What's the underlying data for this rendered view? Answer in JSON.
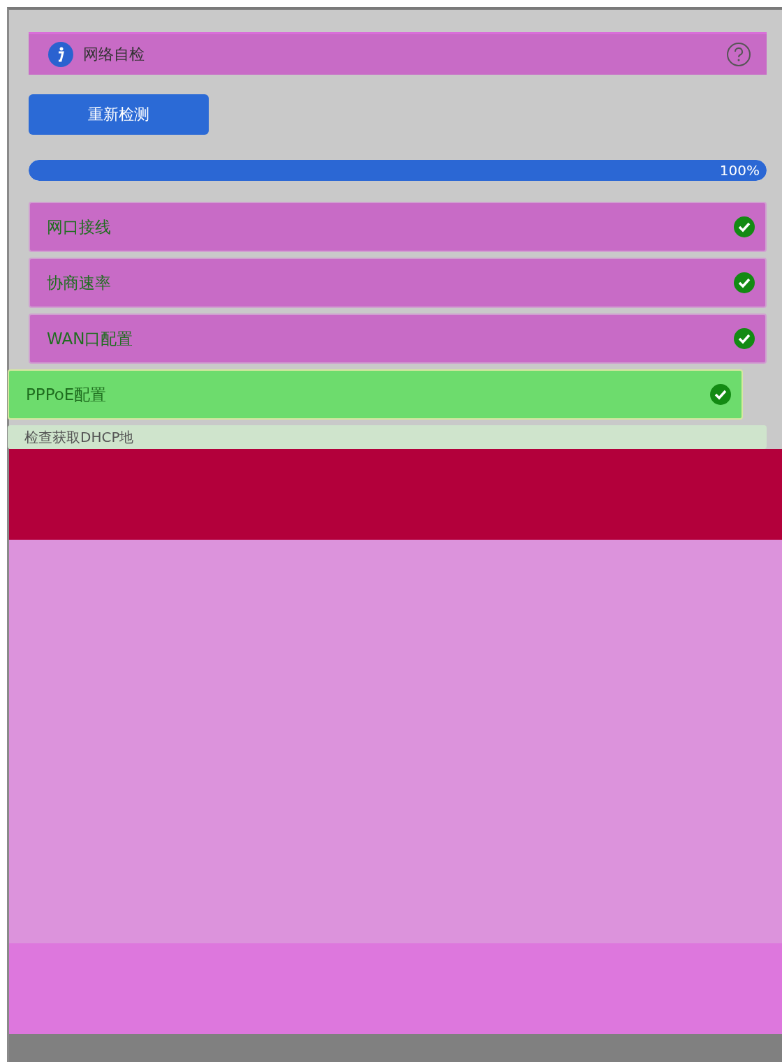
{
  "header": {
    "title": "网络自检"
  },
  "recheck_button": {
    "label": "重新检测"
  },
  "progress": {
    "level": 1,
    "reading": "100%"
  },
  "checks": [
    {
      "label": "网口接线",
      "passed": true
    },
    {
      "label": "协商速率",
      "passed": true
    },
    {
      "label": "WAN口配置",
      "passed": true
    },
    {
      "label": "PPPoE配置",
      "passed": true
    },
    {
      "label": "检查获取DHCP地",
      "passed": false
    }
  ]
}
